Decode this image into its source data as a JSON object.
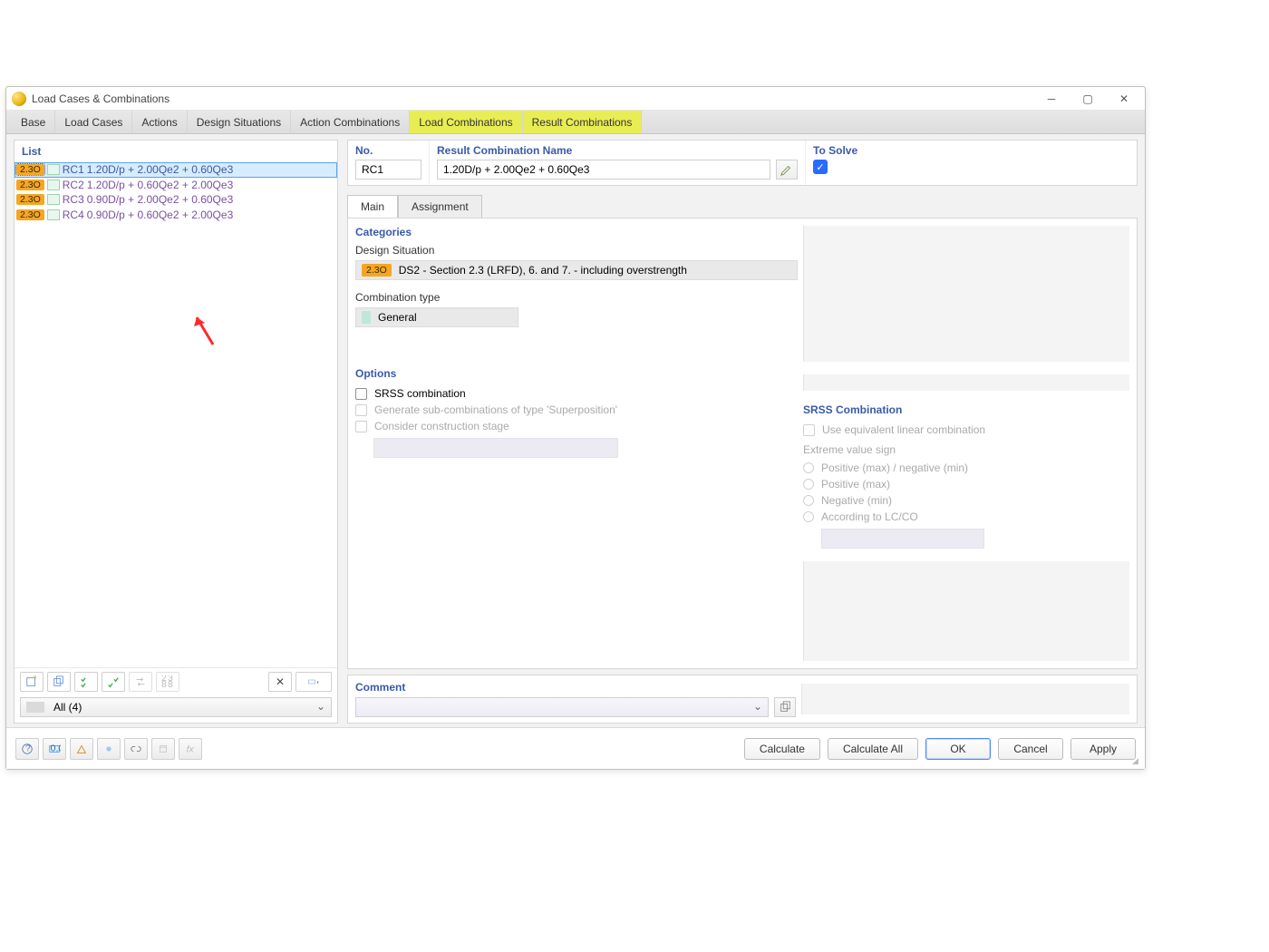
{
  "window": {
    "title": "Load Cases & Combinations"
  },
  "tabs": [
    "Base",
    "Load Cases",
    "Actions",
    "Design Situations",
    "Action Combinations",
    "Load Combinations",
    "Result Combinations"
  ],
  "tabs_hl": [
    5,
    6
  ],
  "left": {
    "header": "List",
    "rows": [
      {
        "badge": "2.3O",
        "rc": "RC1",
        "expr": "1.20D/p + 2.00Qe2 + 0.60Qe3",
        "selected": true
      },
      {
        "badge": "2.3O",
        "rc": "RC2",
        "expr": "1.20D/p + 0.60Qe2 + 2.00Qe3",
        "selected": false
      },
      {
        "badge": "2.3O",
        "rc": "RC3",
        "expr": "0.90D/p + 2.00Qe2 + 0.60Qe3",
        "selected": false
      },
      {
        "badge": "2.3O",
        "rc": "RC4",
        "expr": "0.90D/p + 0.60Qe2 + 2.00Qe3",
        "selected": false
      }
    ],
    "filter": "All (4)"
  },
  "header_fields": {
    "no_lbl": "No.",
    "no_val": "RC1",
    "name_lbl": "Result Combination Name",
    "name_val": "1.20D/p + 2.00Qe2 + 0.60Qe3",
    "tosolve_lbl": "To Solve",
    "tosolve_checked": true
  },
  "subtabs": {
    "main": "Main",
    "assignment": "Assignment",
    "active": "Main"
  },
  "categories": {
    "title": "Categories",
    "ds_label": "Design Situation",
    "ds_badge": "2.3O",
    "ds_text": "DS2 - Section 2.3 (LRFD), 6. and 7. - including overstrength",
    "ct_label": "Combination type",
    "ct_text": "General"
  },
  "options": {
    "title": "Options",
    "srss": "SRSS combination",
    "gensub": "Generate sub-combinations of type 'Superposition'",
    "constage": "Consider construction stage"
  },
  "srss_panel": {
    "title": "SRSS Combination",
    "uselin": "Use equivalent linear combination",
    "evs_label": "Extreme value sign",
    "opts": [
      "Positive (max) / negative (min)",
      "Positive (max)",
      "Negative (min)",
      "According to LC/CO"
    ]
  },
  "comment": {
    "label": "Comment"
  },
  "buttons": {
    "calc": "Calculate",
    "calcall": "Calculate All",
    "ok": "OK",
    "cancel": "Cancel",
    "apply": "Apply"
  }
}
